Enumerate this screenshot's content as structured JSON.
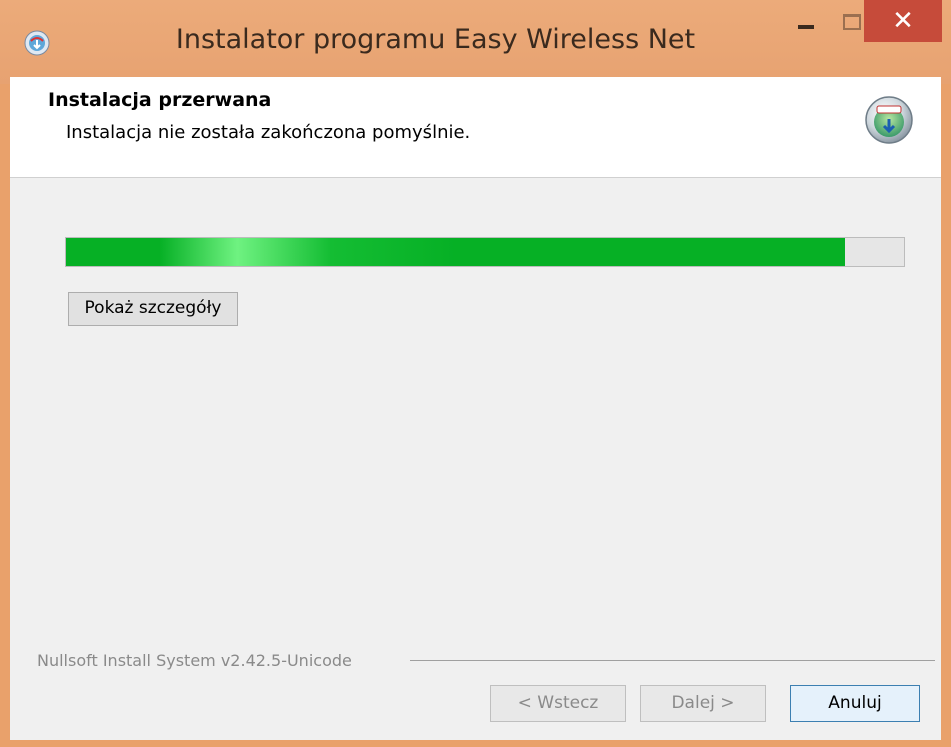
{
  "window": {
    "title": "Instalator programu Easy Wireless Net",
    "minimize_label": "–",
    "maximize_label": "□",
    "close_label": "✕"
  },
  "header": {
    "title": "Instalacja przerwana",
    "subtitle": "Instalacja nie została zakończona pomyślnie."
  },
  "progress": {
    "value_fraction": 0.93
  },
  "details_button": {
    "label": "Pokaż szczegóły"
  },
  "footer": {
    "brand_text": "Nullsoft Install System v2.42.5-Unicode",
    "back_label": "< Wstecz",
    "next_label": "Dalej >",
    "cancel_label": "Anuluj"
  },
  "colors": {
    "titlebar": "#e9a16b",
    "close_button": "#c64b3a",
    "progress_fill": "#06b025",
    "cancel_border": "#3c7fb1"
  },
  "icons": {
    "app": "installer-disc-icon",
    "header_logo": "nsis-logo-icon"
  }
}
